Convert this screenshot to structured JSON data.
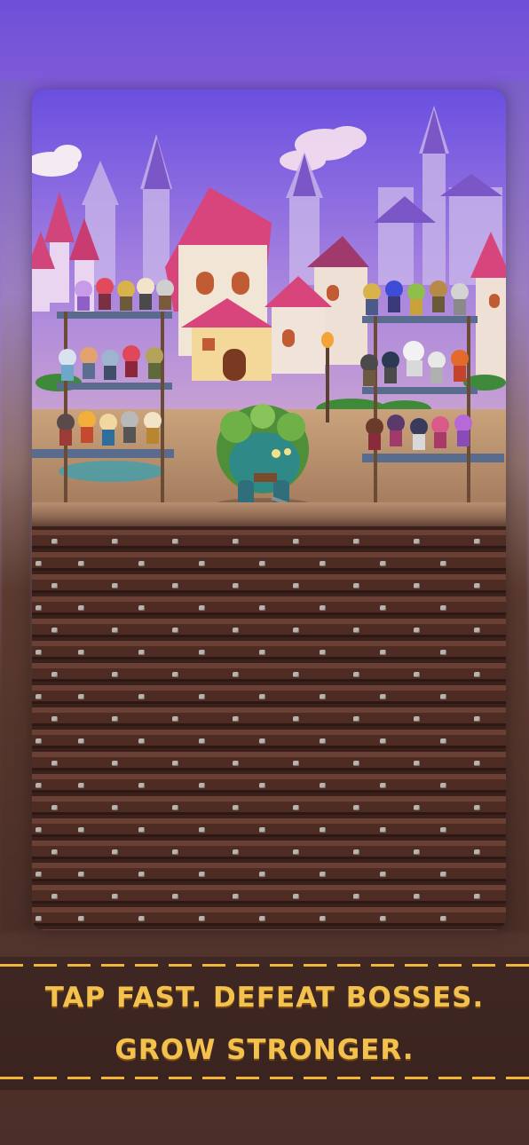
{
  "banner": {
    "line1": "TAP FAST. DEFEAT BOSSES.",
    "line2": "GROW STRONGER."
  },
  "colors": {
    "sky_top": "#6e4fd8",
    "roof_pink": "#d2457b",
    "tower_purple": "#7b57c4",
    "dirt_brown": "#4e2c24",
    "banner_gold": "#f3c14e",
    "boss_green": "#4f8f3a"
  },
  "scene": {
    "left_rack_heroes": 15,
    "right_rack_heroes": 15,
    "boss": "green-ogre-boss"
  }
}
